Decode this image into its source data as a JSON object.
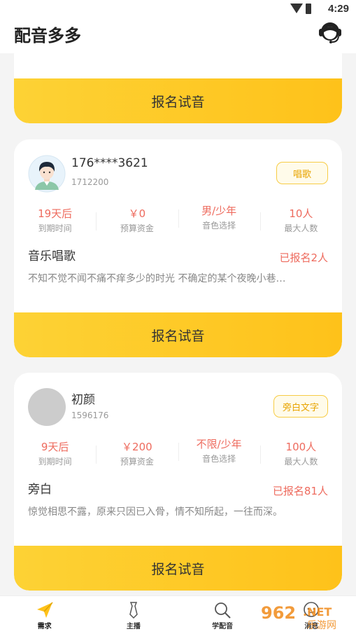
{
  "status": {
    "time": "4:29"
  },
  "app": {
    "title": "配音多多"
  },
  "cards": [
    {
      "apply_label": "报名试音"
    },
    {
      "name": "176****3621",
      "uid": "1712200",
      "tag": "唱歌",
      "stats": [
        {
          "value": "19天后",
          "label": "到期时间"
        },
        {
          "value": "￥0",
          "label": "预算资金"
        },
        {
          "value": "男/少年",
          "label": "音色选择"
        },
        {
          "value": "10人",
          "label": "最大人数"
        }
      ],
      "theme": "音乐唱歌",
      "signed": "已报名2人",
      "desc": "不知不觉不闻不痛不痒多少的时光 不确定的某个夜晚小巷…",
      "apply_label": "报名试音"
    },
    {
      "name": "初颜",
      "uid": "1596176",
      "tag": "旁白文字",
      "stats": [
        {
          "value": "9天后",
          "label": "到期时间"
        },
        {
          "value": "￥200",
          "label": "预算资金"
        },
        {
          "value": "不限/少年",
          "label": "音色选择"
        },
        {
          "value": "100人",
          "label": "最大人数"
        }
      ],
      "theme": "旁白",
      "signed": "已报名81人",
      "desc": "惊觉相思不露，原来只因已入骨，情不知所起，一往而深。",
      "apply_label": "报名试音"
    }
  ],
  "tabs": [
    {
      "label": "需求",
      "icon": "paper-plane-icon"
    },
    {
      "label": "主播",
      "icon": "tie-icon"
    },
    {
      "label": "学配音",
      "icon": "magnifier-icon"
    },
    {
      "label": "消息",
      "icon": "chat-bubble-icon"
    }
  ],
  "watermark": {
    "text1": "962",
    "text2": ".NET",
    "text3": "乐游网"
  },
  "colors": {
    "accent": "#fec21a",
    "highlight": "#ee6b5e",
    "tag_border": "#f7cc45"
  }
}
